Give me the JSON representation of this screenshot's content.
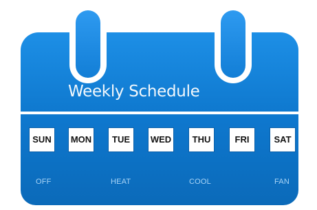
{
  "header": {
    "title": "Weekly Schedule"
  },
  "days": [
    {
      "label": "SUN"
    },
    {
      "label": "MON"
    },
    {
      "label": "TUE"
    },
    {
      "label": "WED"
    },
    {
      "label": "THU"
    },
    {
      "label": "FRI"
    },
    {
      "label": "SAT"
    }
  ],
  "modes": [
    {
      "label": "OFF"
    },
    {
      "label": "HEAT"
    },
    {
      "label": "COOL"
    },
    {
      "label": "FAN"
    }
  ],
  "colors": {
    "accent": "#0f79cf",
    "accent_light": "#1d8fe6",
    "legend_text": "#a9d4f7",
    "button_bg": "#ffffff"
  },
  "icons": {
    "calendar": "calendar-icon",
    "ring": "binder-ring-icon"
  }
}
